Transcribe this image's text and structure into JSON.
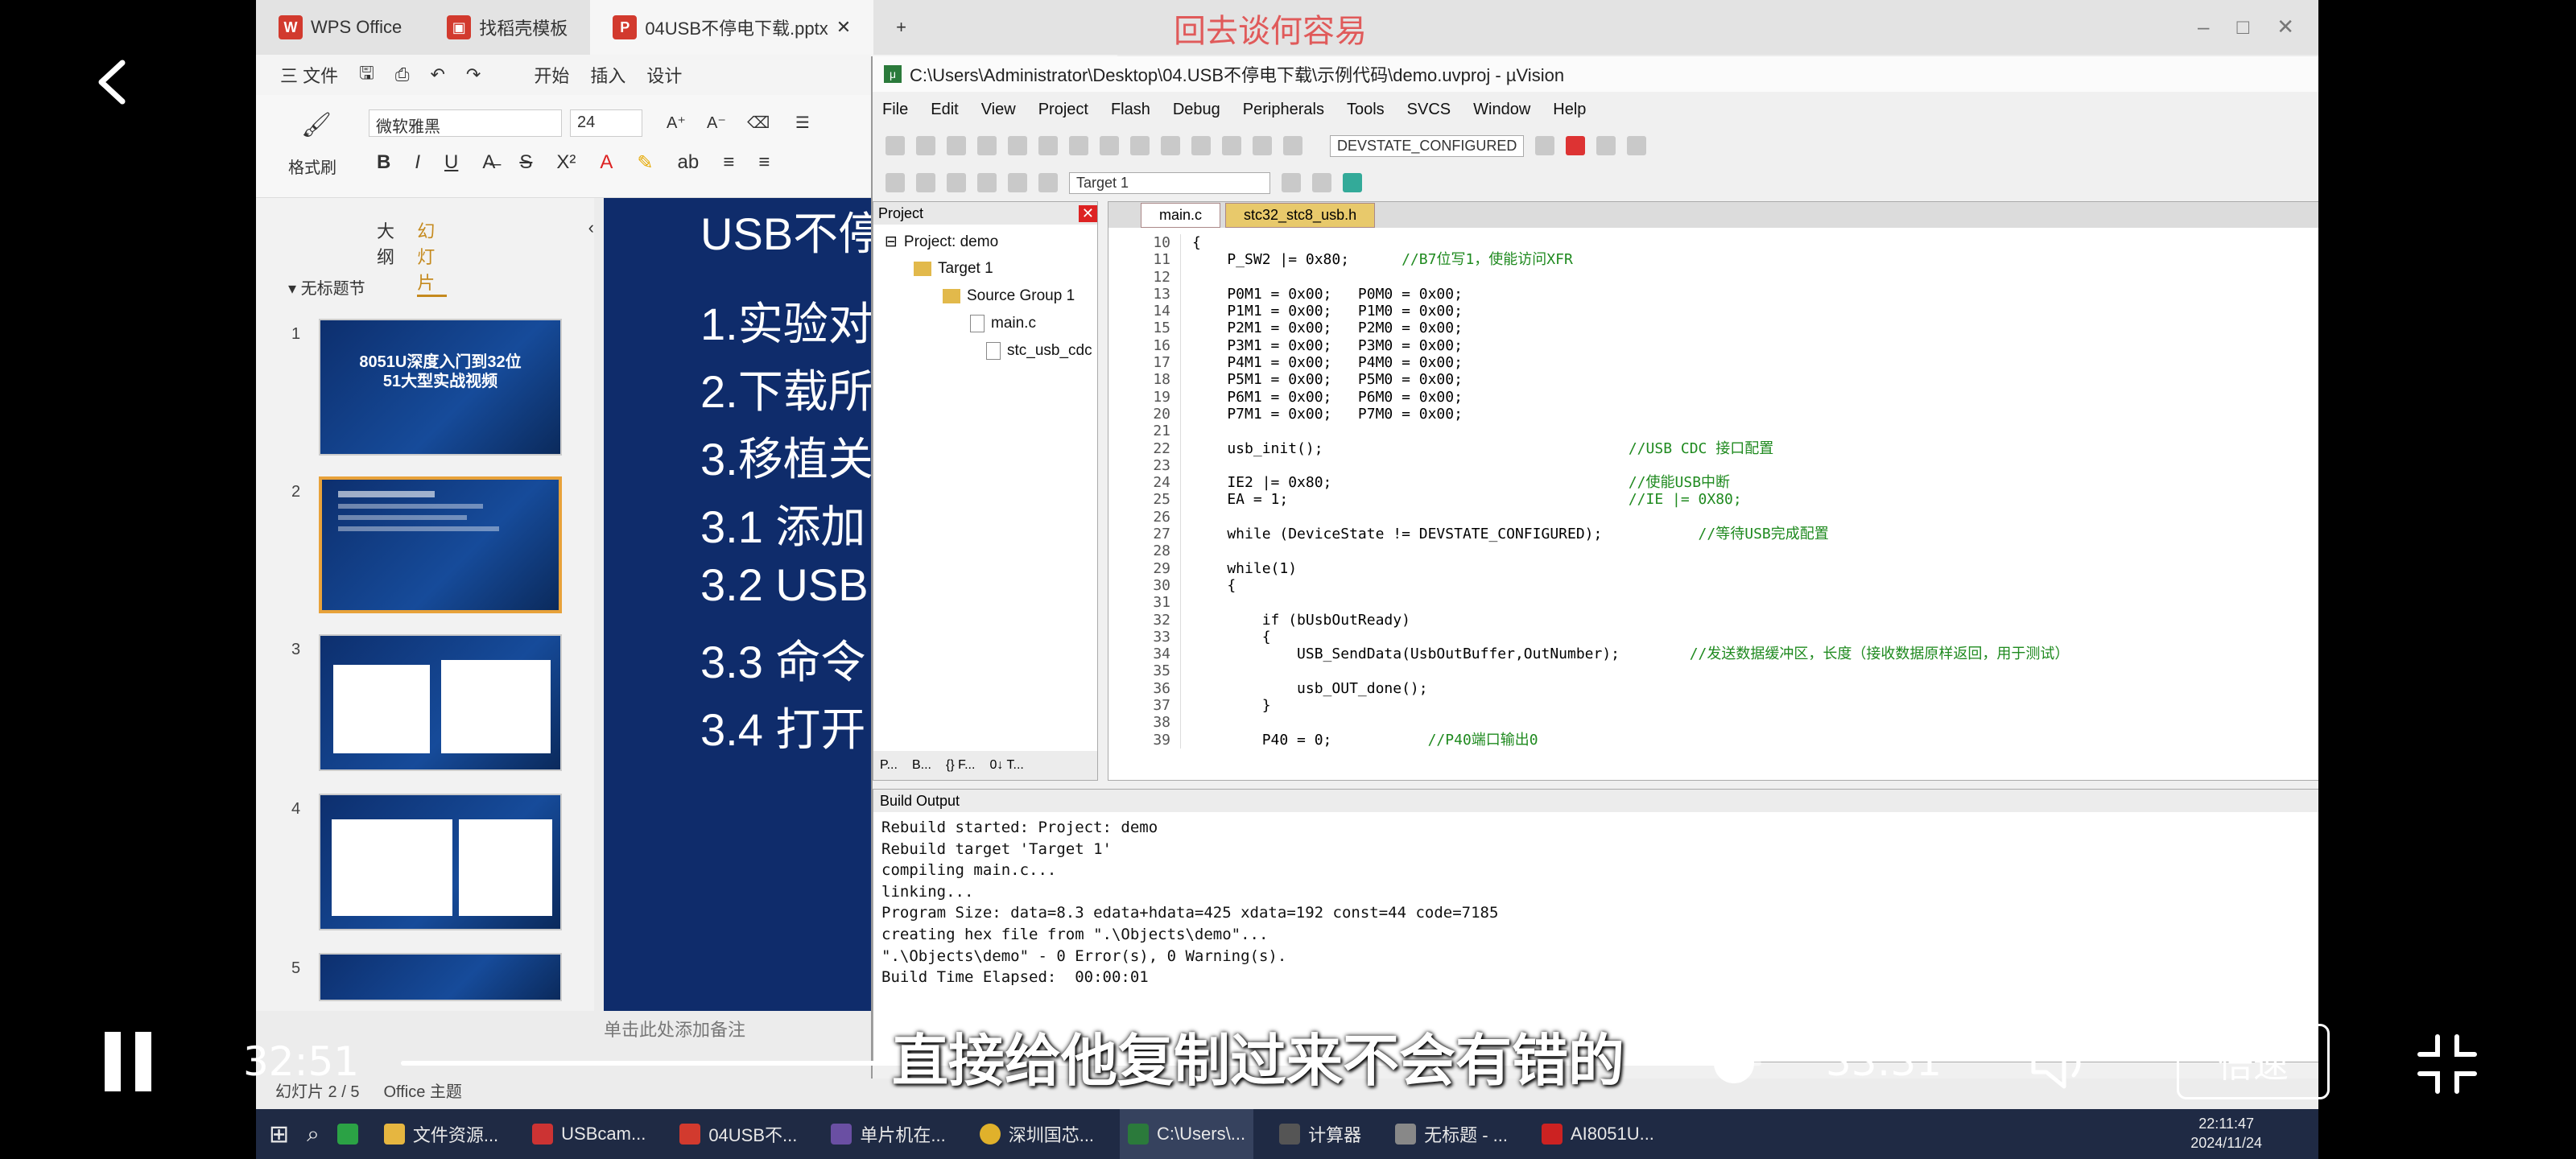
{
  "wps": {
    "tabs": [
      "WPS Office",
      "找稻壳模板",
      "04USB不停电下载.pptx"
    ],
    "watermark": "回去谈何容易",
    "menu": [
      "三 文件",
      "开始",
      "插入",
      "设计"
    ],
    "font_name": "微软雅黑",
    "font_size": "24",
    "format_brush": "格式刷",
    "pane_tabs": [
      "大纲",
      "幻灯片"
    ],
    "section": "无标题节",
    "thumb1_title": "8051U深度入门到32位\n51大型实战视频",
    "slide": {
      "title": "USB不停",
      "lines": [
        "1.实验对",
        "2.下载所",
        "3.移植关",
        "3.1 添加",
        "3.2 USB",
        "3.3 命令",
        "3.4 打开"
      ]
    },
    "notes": "单击此处添加备注",
    "status_slide": "幻灯片 2 / 5",
    "status_theme": "Office 主题"
  },
  "uv": {
    "title": "C:\\Users\\Administrator\\Desktop\\04.USB不停电下载\\示例代码\\demo.uvproj - µVision",
    "menu": [
      "File",
      "Edit",
      "View",
      "Project",
      "Flash",
      "Debug",
      "Peripherals",
      "Tools",
      "SVCS",
      "Window",
      "Help"
    ],
    "toolbar_combo": "DEVSTATE_CONFIGURED",
    "target_combo": "Target 1",
    "project_panel_title": "Project",
    "tree": [
      "Project: demo",
      "Target 1",
      "Source Group 1",
      "main.c",
      "stc_usb_cdc"
    ],
    "editor_tabs": [
      "main.c",
      "stc32_stc8_usb.h"
    ],
    "build_title": "Build Output",
    "build_lines": [
      "Rebuild started: Project: demo",
      "Rebuild target 'Target 1'",
      "compiling main.c...",
      "linking...",
      "Program Size: data=8.3 edata+hdata=425 xdata=192 const=44 code=7185",
      "creating hex file from \".\\Objects\\demo\"...",
      "\".\\Objects\\demo\" - 0 Error(s), 0 Warning(s).",
      "Build Time Elapsed:  00:00:01"
    ],
    "code": [
      {
        "n": "10",
        "t": "{",
        "c": ""
      },
      {
        "n": "11",
        "t": "    P_SW2 |= 0x80;",
        "c": "//B7位写1，使能访问XFR"
      },
      {
        "n": "12",
        "t": "",
        "c": ""
      },
      {
        "n": "13",
        "t": "    P0M1 = 0x00;   P0M0 = 0x00;",
        "c": ""
      },
      {
        "n": "14",
        "t": "    P1M1 = 0x00;   P1M0 = 0x00;",
        "c": ""
      },
      {
        "n": "15",
        "t": "    P2M1 = 0x00;   P2M0 = 0x00;",
        "c": ""
      },
      {
        "n": "16",
        "t": "    P3M1 = 0x00;   P3M0 = 0x00;",
        "c": ""
      },
      {
        "n": "17",
        "t": "    P4M1 = 0x00;   P4M0 = 0x00;",
        "c": ""
      },
      {
        "n": "18",
        "t": "    P5M1 = 0x00;   P5M0 = 0x00;",
        "c": ""
      },
      {
        "n": "19",
        "t": "    P6M1 = 0x00;   P6M0 = 0x00;",
        "c": ""
      },
      {
        "n": "20",
        "t": "    P7M1 = 0x00;   P7M0 = 0x00;",
        "c": ""
      },
      {
        "n": "21",
        "t": "",
        "c": ""
      },
      {
        "n": "22",
        "t": "    usb_init();                             ",
        "c": "//USB CDC 接口配置"
      },
      {
        "n": "23",
        "t": "",
        "c": ""
      },
      {
        "n": "24",
        "t": "    IE2 |= 0x80;                            ",
        "c": "//使能USB中断"
      },
      {
        "n": "25",
        "t": "    EA = 1;                                 ",
        "c": "//IE |= 0X80;"
      },
      {
        "n": "26",
        "t": "",
        "c": ""
      },
      {
        "n": "27",
        "t": "    while (DeviceState != DEVSTATE_CONFIGURED);     ",
        "c": "//等待USB完成配置"
      },
      {
        "n": "28",
        "t": "",
        "c": ""
      },
      {
        "n": "29",
        "t": "    while(1)",
        "c": ""
      },
      {
        "n": "30",
        "t": "    {",
        "c": ""
      },
      {
        "n": "31",
        "t": "",
        "c": ""
      },
      {
        "n": "32",
        "t": "        if (bUsbOutReady)",
        "c": ""
      },
      {
        "n": "33",
        "t": "        {",
        "c": ""
      },
      {
        "n": "34",
        "t": "            USB_SendData(UsbOutBuffer,OutNumber);  ",
        "c": "//发送数据缓冲区，长度（接收数据原样返回，用于测试）"
      },
      {
        "n": "35",
        "t": "",
        "c": ""
      },
      {
        "n": "36",
        "t": "            usb_OUT_done();",
        "c": ""
      },
      {
        "n": "37",
        "t": "        }",
        "c": ""
      },
      {
        "n": "38",
        "t": "",
        "c": ""
      },
      {
        "n": "39",
        "t": "        P40 = 0;     ",
        "c": "//P40端口输出0"
      }
    ]
  },
  "taskbar": {
    "items": [
      "文件资源...",
      "USBcam...",
      "04USB不...",
      "单片机在...",
      "深圳国芯...",
      "C:\\Users\\...",
      "计算器",
      "无标题 - ...",
      "AI8051U..."
    ],
    "time": "22:11:47",
    "date": "2024/11/24"
  },
  "player": {
    "elapsed": "32:51",
    "total": "33:31",
    "subtitle": "直接给他复制过来不会有错的",
    "speed_label": "倍速",
    "progress": 0.98
  }
}
